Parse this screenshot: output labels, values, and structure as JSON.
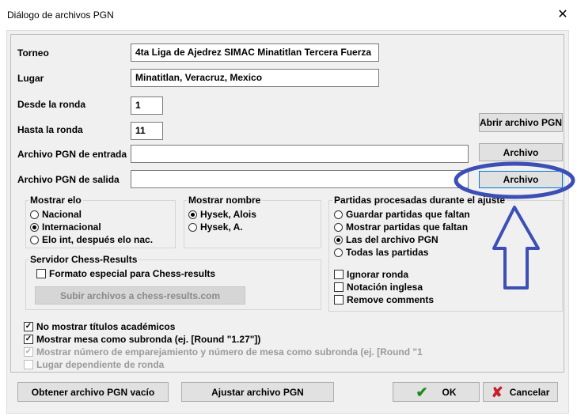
{
  "window": {
    "title": "Diálogo de archivos PGN",
    "close": "✕"
  },
  "fields": {
    "torneo_label": "Torneo",
    "torneo_value": "4ta Liga de Ajedrez SIMAC Minatitlan Tercera Fuerza",
    "lugar_label": "Lugar",
    "lugar_value": "Minatitlan, Veracruz, Mexico",
    "desde_label": "Desde la ronda",
    "desde_value": "1",
    "hasta_label": "Hasta la ronda",
    "hasta_value": "11",
    "entrada_label": "Archivo PGN de entrada",
    "entrada_value": "",
    "salida_label": "Archivo PGN de salida",
    "salida_value": ""
  },
  "buttons": {
    "abrir": "Abrir archivo PGN",
    "archivo_entrada": "Archivo",
    "archivo_salida": "Archivo",
    "subir": "Subir archivos a chess-results.com",
    "obtener": "Obtener archivo PGN vacío",
    "ajustar": "Ajustar archivo PGN",
    "ok": "OK",
    "cancelar": "Cancelar"
  },
  "elo_group": {
    "title": "Mostrar elo",
    "options": [
      "Nacional",
      "Internacional",
      "Elo int, después elo nac."
    ],
    "selected": 1
  },
  "nombre_group": {
    "title": "Mostrar nombre",
    "options": [
      "Hysek, Alois",
      "Hysek, A."
    ],
    "selected": 0
  },
  "partidas_group": {
    "title": "Partidas procesadas durante el ajuste",
    "options": [
      "Guardar partidas que faltan",
      "Mostrar partidas que faltan",
      "Las del archivo PGN",
      "Todas las partidas"
    ],
    "selected": 2,
    "checks": [
      "Ignorar ronda",
      "Notación inglesa",
      "Remove comments"
    ]
  },
  "server_group": {
    "title": "Servidor Chess-Results",
    "check": "Formato especial para Chess-results"
  },
  "bottom_checks": {
    "c1": "No mostrar títulos académicos",
    "c2": "Mostrar mesa como subronda (ej. [Round \"1.27\"])",
    "c3": "Mostrar número de emparejamiento y número de mesa como subronda (ej. [Round \"1",
    "c4": "Lugar dependiente de ronda"
  },
  "annotation": {
    "color": "#3c4fb5"
  },
  "colors": {
    "ok": "#1f8a1f",
    "cancel": "#c8202a"
  }
}
